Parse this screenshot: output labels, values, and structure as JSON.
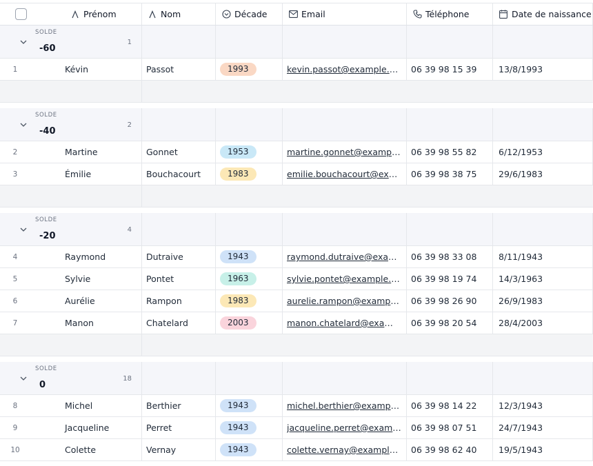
{
  "columns": [
    {
      "label": "Prénom",
      "icon": "text-icon"
    },
    {
      "label": "Nom",
      "icon": "text-icon"
    },
    {
      "label": "Décade",
      "icon": "single-select-icon"
    },
    {
      "label": "Email",
      "icon": "mail-icon"
    },
    {
      "label": "Téléphone",
      "icon": "phone-icon"
    },
    {
      "label": "Date de naissance",
      "icon": "calendar-icon"
    }
  ],
  "group_label": "SOLDE",
  "decade_colors": {
    "1943": "#cfe2f8",
    "1953": "#c9e8f7",
    "1963": "#c7f0e8",
    "1983": "#fce8b6",
    "1993": "#fad8c4",
    "2003": "#fad4dc"
  },
  "groups": [
    {
      "value": "-60",
      "count": "1",
      "rows": [
        {
          "num": "1",
          "first": "Kévin",
          "last": "Passot",
          "decade": "1993",
          "email": "kevin.passot@example.com",
          "phone": "06 39 98 15 39",
          "birth": "13/8/1993"
        }
      ]
    },
    {
      "value": "-40",
      "count": "2",
      "rows": [
        {
          "num": "2",
          "first": "Martine",
          "last": "Gonnet",
          "decade": "1953",
          "email": "martine.gonnet@example.com",
          "phone": "06 39 98 55 82",
          "birth": "6/12/1953"
        },
        {
          "num": "3",
          "first": "Émilie",
          "last": "Bouchacourt",
          "decade": "1983",
          "email": "emilie.bouchacourt@example.com",
          "phone": "06 39 98 38 75",
          "birth": "29/6/1983"
        }
      ]
    },
    {
      "value": "-20",
      "count": "4",
      "rows": [
        {
          "num": "4",
          "first": "Raymond",
          "last": "Dutraive",
          "decade": "1943",
          "email": "raymond.dutraive@example.com",
          "phone": "06 39 98 33 08",
          "birth": "8/11/1943"
        },
        {
          "num": "5",
          "first": "Sylvie",
          "last": "Pontet",
          "decade": "1963",
          "email": "sylvie.pontet@example.com",
          "phone": "06 39 98 19 74",
          "birth": "14/3/1963"
        },
        {
          "num": "6",
          "first": "Aurélie",
          "last": "Rampon",
          "decade": "1983",
          "email": "aurelie.rampon@example.com",
          "phone": "06 39 98 26 90",
          "birth": "26/9/1983"
        },
        {
          "num": "7",
          "first": "Manon",
          "last": "Chatelard",
          "decade": "2003",
          "email": "manon.chatelard@example.com",
          "phone": "06 39 98 20 54",
          "birth": "28/4/2003"
        }
      ]
    },
    {
      "value": "0",
      "count": "18",
      "rows": [
        {
          "num": "8",
          "first": "Michel",
          "last": "Berthier",
          "decade": "1943",
          "email": "michel.berthier@example.com",
          "phone": "06 39 98 14 22",
          "birth": "12/3/1943"
        },
        {
          "num": "9",
          "first": "Jacqueline",
          "last": "Perret",
          "decade": "1943",
          "email": "jacqueline.perret@example.com",
          "phone": "06 39 98 07 51",
          "birth": "24/7/1943"
        },
        {
          "num": "10",
          "first": "Colette",
          "last": "Vernay",
          "decade": "1943",
          "email": "colette.vernay@example.com",
          "phone": "06 39 98 62 40",
          "birth": "19/5/1943"
        }
      ]
    }
  ]
}
